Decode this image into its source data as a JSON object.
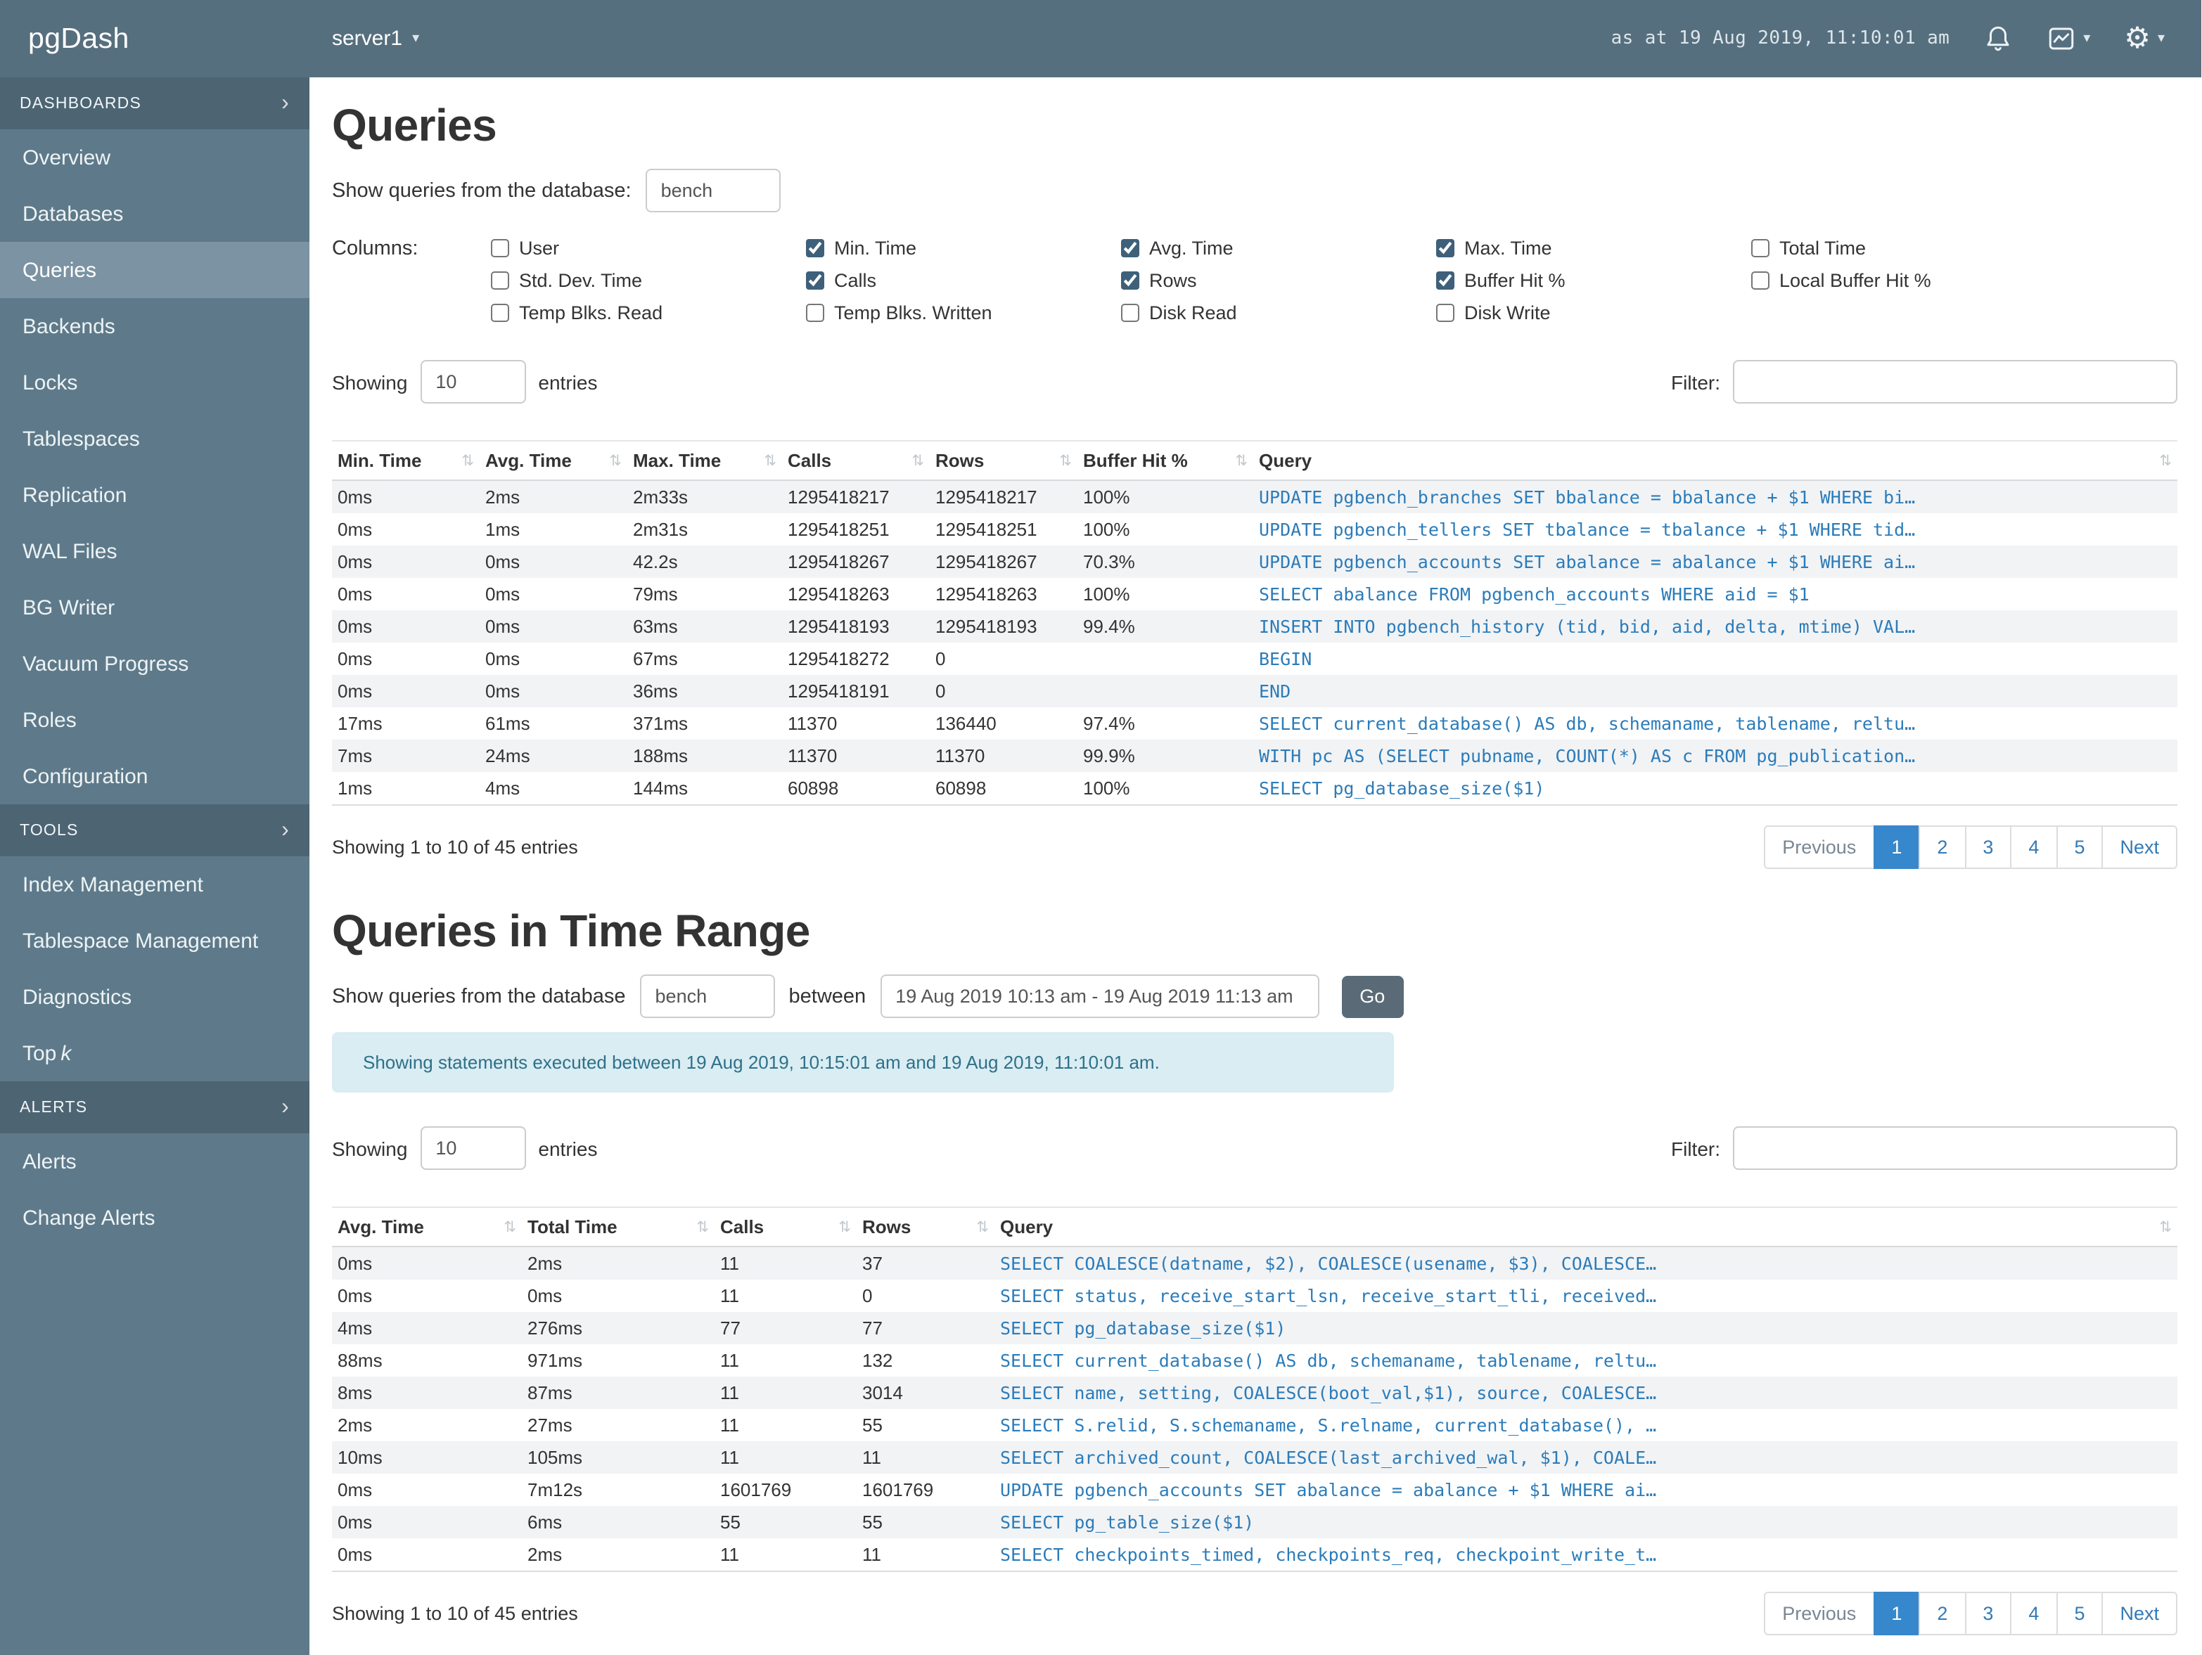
{
  "colors": {
    "navbar": "#566f7e",
    "sidebar": "#5e7a8a",
    "sidebar_header": "#4d6473",
    "sidebar_selected": "#7b93a2",
    "link": "#2b7cba",
    "pagination_active": "#3787cc",
    "alert_bg": "#d9edf3",
    "alert_text": "#2f7089",
    "button": "#5a6b77"
  },
  "icons": {
    "sort_glyph": "⇅",
    "chevron_right_glyph": "›",
    "caret_down_glyph": "▾",
    "gear_glyph": "⚙"
  },
  "navbar": {
    "brand": "pgDash",
    "server": "server1",
    "timestamp": "as at 19 Aug 2019, 11:10:01 am"
  },
  "sidebar": {
    "sections": [
      {
        "label": "DASHBOARDS",
        "items": [
          {
            "label": "Overview"
          },
          {
            "label": "Databases"
          },
          {
            "label": "Queries",
            "selected": true
          },
          {
            "label": "Backends"
          },
          {
            "label": "Locks"
          },
          {
            "label": "Tablespaces"
          },
          {
            "label": "Replication"
          },
          {
            "label": "WAL Files"
          },
          {
            "label": "BG Writer"
          },
          {
            "label": "Vacuum Progress"
          },
          {
            "label": "Roles"
          },
          {
            "label": "Configuration"
          }
        ]
      },
      {
        "label": "TOOLS",
        "items": [
          {
            "label": "Index Management"
          },
          {
            "label": "Tablespace Management"
          },
          {
            "label": "Diagnostics"
          },
          {
            "label": "Top",
            "italic": "k"
          }
        ]
      },
      {
        "label": "ALERTS",
        "items": [
          {
            "label": "Alerts"
          },
          {
            "label": "Change Alerts"
          }
        ]
      }
    ]
  },
  "queries": {
    "title": "Queries",
    "db_label": "Show queries from the database:",
    "db_value": "bench",
    "columns_label": "Columns:",
    "column_groups": [
      [
        {
          "label": "User",
          "checked": false
        },
        {
          "label": "Std. Dev. Time",
          "checked": false
        },
        {
          "label": "Temp Blks. Read",
          "checked": false
        }
      ],
      [
        {
          "label": "Min. Time",
          "checked": true
        },
        {
          "label": "Calls",
          "checked": true
        },
        {
          "label": "Temp Blks. Written",
          "checked": false
        }
      ],
      [
        {
          "label": "Avg. Time",
          "checked": true
        },
        {
          "label": "Rows",
          "checked": true
        },
        {
          "label": "Disk Read",
          "checked": false
        }
      ],
      [
        {
          "label": "Max. Time",
          "checked": true
        },
        {
          "label": "Buffer Hit %",
          "checked": true
        },
        {
          "label": "Disk Write",
          "checked": false
        }
      ],
      [
        {
          "label": "Total Time",
          "checked": false
        },
        {
          "label": "Local Buffer Hit %",
          "checked": false
        }
      ]
    ],
    "showing_label": "Showing",
    "entries_value": "10",
    "entries_label": "entries",
    "filter_label": "Filter:",
    "filter_value": "",
    "table": {
      "headers": [
        "Min. Time",
        "Avg. Time",
        "Max. Time",
        "Calls",
        "Rows",
        "Buffer Hit %",
        "Query"
      ],
      "rows": [
        [
          "0ms",
          "2ms",
          "2m33s",
          "1295418217",
          "1295418217",
          "100%",
          "UPDATE pgbench_branches SET bbalance = bbalance + $1 WHERE bi…"
        ],
        [
          "0ms",
          "1ms",
          "2m31s",
          "1295418251",
          "1295418251",
          "100%",
          "UPDATE pgbench_tellers SET tbalance = tbalance + $1 WHERE tid…"
        ],
        [
          "0ms",
          "0ms",
          "42.2s",
          "1295418267",
          "1295418267",
          "70.3%",
          "UPDATE pgbench_accounts SET abalance = abalance + $1 WHERE ai…"
        ],
        [
          "0ms",
          "0ms",
          "79ms",
          "1295418263",
          "1295418263",
          "100%",
          "SELECT abalance FROM pgbench_accounts WHERE aid = $1"
        ],
        [
          "0ms",
          "0ms",
          "63ms",
          "1295418193",
          "1295418193",
          "99.4%",
          "INSERT INTO pgbench_history (tid, bid, aid, delta, mtime) VAL…"
        ],
        [
          "0ms",
          "0ms",
          "67ms",
          "1295418272",
          "0",
          "",
          "BEGIN"
        ],
        [
          "0ms",
          "0ms",
          "36ms",
          "1295418191",
          "0",
          "",
          "END"
        ],
        [
          "17ms",
          "61ms",
          "371ms",
          "11370",
          "136440",
          "97.4%",
          "SELECT current_database() AS db, schemaname, tablename, reltu…"
        ],
        [
          "7ms",
          "24ms",
          "188ms",
          "11370",
          "11370",
          "99.9%",
          "WITH pc AS (SELECT pubname, COUNT(*) AS c FROM pg_publication…"
        ],
        [
          "1ms",
          "4ms",
          "144ms",
          "60898",
          "60898",
          "100%",
          "SELECT pg_database_size($1)"
        ]
      ]
    },
    "summary": "Showing 1 to 10 of 45 entries",
    "pagination": {
      "previous": "Previous",
      "pages": [
        "1",
        "2",
        "3",
        "4",
        "5"
      ],
      "active": "1",
      "next": "Next"
    }
  },
  "time_range": {
    "title": "Queries in Time Range",
    "db_label": "Show queries from the database",
    "db_value": "bench",
    "between_label": "between",
    "range_value": "19 Aug 2019 10:13 am - 19 Aug 2019 11:13 am",
    "go_label": "Go",
    "alert": "Showing statements executed between 19 Aug 2019, 10:15:01 am and 19 Aug 2019, 11:10:01 am.",
    "showing_label": "Showing",
    "entries_value": "10",
    "entries_label": "entries",
    "filter_label": "Filter:",
    "filter_value": "",
    "table": {
      "headers": [
        "Avg. Time",
        "Total Time",
        "Calls",
        "Rows",
        "Query"
      ],
      "rows": [
        [
          "0ms",
          "2ms",
          "11",
          "37",
          "SELECT COALESCE(datname, $2), COALESCE(usename, $3), COALESCE…"
        ],
        [
          "0ms",
          "0ms",
          "11",
          "0",
          "SELECT status, receive_start_lsn, receive_start_tli, received…"
        ],
        [
          "4ms",
          "276ms",
          "77",
          "77",
          "SELECT pg_database_size($1)"
        ],
        [
          "88ms",
          "971ms",
          "11",
          "132",
          "SELECT current_database() AS db, schemaname, tablename, reltu…"
        ],
        [
          "8ms",
          "87ms",
          "11",
          "3014",
          "SELECT name, setting, COALESCE(boot_val,$1), source, COALESCE…"
        ],
        [
          "2ms",
          "27ms",
          "11",
          "55",
          "SELECT S.relid, S.schemaname, S.relname, current_database(), …"
        ],
        [
          "10ms",
          "105ms",
          "11",
          "11",
          "SELECT archived_count, COALESCE(last_archived_wal, $1), COALE…"
        ],
        [
          "0ms",
          "7m12s",
          "1601769",
          "1601769",
          "UPDATE pgbench_accounts SET abalance = abalance + $1 WHERE ai…"
        ],
        [
          "0ms",
          "6ms",
          "55",
          "55",
          "SELECT pg_table_size($1)"
        ],
        [
          "0ms",
          "2ms",
          "11",
          "11",
          "SELECT checkpoints_timed, checkpoints_req, checkpoint_write_t…"
        ]
      ]
    },
    "summary": "Showing 1 to 10 of 45 entries",
    "pagination": {
      "previous": "Previous",
      "pages": [
        "1",
        "2",
        "3",
        "4",
        "5"
      ],
      "active": "1",
      "next": "Next"
    }
  }
}
